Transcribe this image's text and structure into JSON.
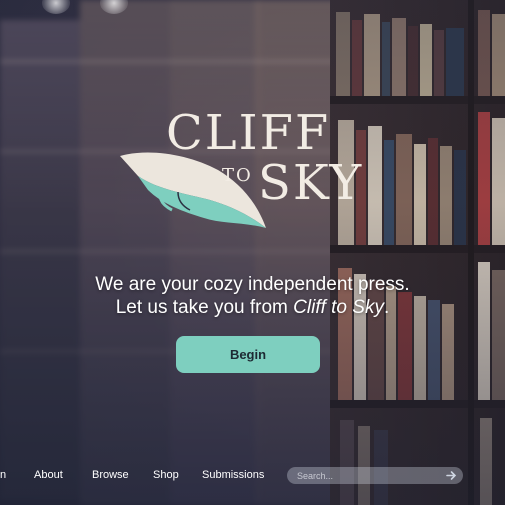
{
  "brand": {
    "line1": "CLIFF",
    "line2_small": "TO",
    "line2_large": "SKY",
    "accent_color": "#7ecfbf"
  },
  "hero": {
    "tagline_line1": "We are your cozy independent press.",
    "tagline_line2_prefix": "Let us take you from ",
    "tagline_line2_emphasis": "Cliff to Sky",
    "tagline_line2_suffix": ".",
    "cta_label": "Begin"
  },
  "nav": {
    "items": [
      {
        "label": "n"
      },
      {
        "label": "About"
      },
      {
        "label": "Browse"
      },
      {
        "label": "Shop"
      },
      {
        "label": "Submissions"
      }
    ],
    "search_placeholder": "Search...",
    "search_icon": "arrow-right-icon"
  }
}
